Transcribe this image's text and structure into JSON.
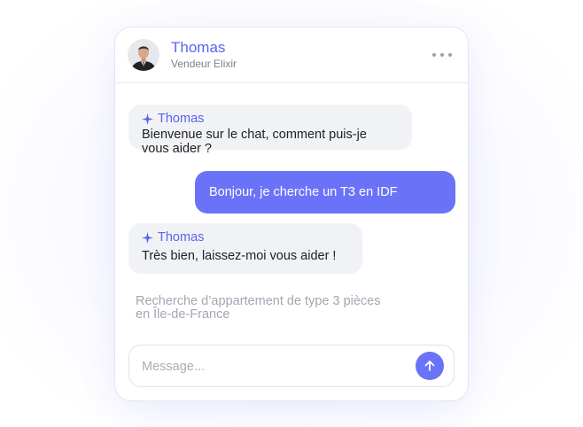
{
  "header": {
    "name": "Thomas",
    "role": "Vendeur Elixir",
    "avatar_icon": "person-avatar-photo",
    "menu_icon": "more-horizontal-icon"
  },
  "messages": [
    {
      "from": "bot",
      "author": "Thomas",
      "text_line1": "Bienvenue sur le chat, comment puis-je",
      "text_line2": "vous aider ?"
    },
    {
      "from": "user",
      "text": "Bonjour, je cherche un T3 en IDF"
    },
    {
      "from": "bot",
      "author": "Thomas",
      "text": "Très bien, laissez-moi vous aider !"
    }
  ],
  "status": {
    "line1": "Recherche d’appartement de type 3 pièces",
    "line2": "en Île-de-France"
  },
  "composer": {
    "placeholder": "Message...",
    "send_icon": "arrow-up-icon"
  },
  "colors": {
    "accent": "#6a73f7",
    "name": "#5a63f0",
    "bot_bubble": "#f1f2f5",
    "muted": "#a3a7b2"
  }
}
